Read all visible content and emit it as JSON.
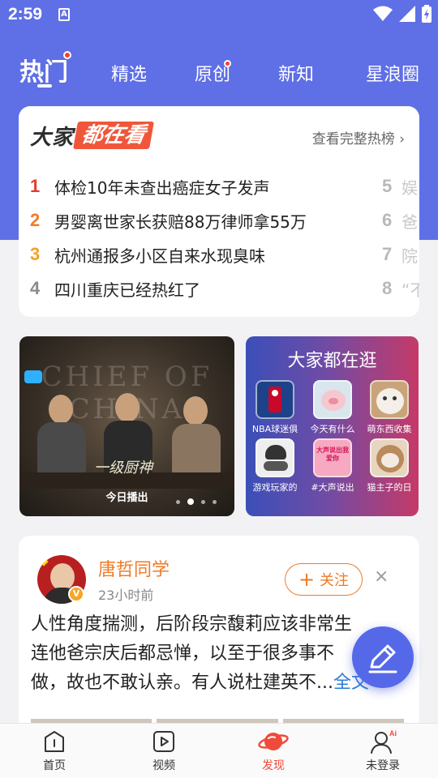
{
  "status_bar": {
    "time": "2:59",
    "indicator": "A"
  },
  "tabs": [
    {
      "label": "热门",
      "active": true,
      "has_dot": true
    },
    {
      "label": "精选",
      "active": false,
      "has_dot": false
    },
    {
      "label": "原创",
      "active": false,
      "has_dot": true
    },
    {
      "label": "新知",
      "active": false,
      "has_dot": false
    },
    {
      "label": "星浪圈",
      "active": false,
      "has_dot": false
    }
  ],
  "hot_board": {
    "logo_part1": "大家",
    "logo_part2": "都在看",
    "more_label": "查看完整热榜 ›",
    "items": [
      {
        "rank": "1",
        "text": "体检10年未查出癌症女子发声",
        "color": "#e63b2e"
      },
      {
        "rank": "2",
        "text": "男婴离世家长获赔88万律师拿55万",
        "color": "#f47a2a"
      },
      {
        "rank": "3",
        "text": "杭州通报多小区自来水现臭味",
        "color": "#f3a12b"
      },
      {
        "rank": "4",
        "text": "四川重庆已经热红了",
        "color": "#8c8c8c"
      }
    ],
    "items_peek": [
      {
        "rank": "5",
        "text": "娱"
      },
      {
        "rank": "6",
        "text": "爸"
      },
      {
        "rank": "7",
        "text": "院"
      },
      {
        "rank": "8",
        "text": "“不"
      }
    ]
  },
  "banner": {
    "bg_title": "CHIEF OF CHINA",
    "show_logo": "一级厨神",
    "caption": "今日播出",
    "dots": [
      false,
      true,
      false,
      false
    ]
  },
  "browse": {
    "title": "大家都在逛",
    "items": [
      {
        "label": "NBA球迷俱",
        "icon": "nba-logo-icon"
      },
      {
        "label": "今天有什么",
        "icon": "pig-icon"
      },
      {
        "label": "萌东西收集",
        "icon": "cat-icon"
      },
      {
        "label": "游戏玩家的",
        "icon": "gamer-icon"
      },
      {
        "label": "#大声说出",
        "icon": "pig-pink-icon",
        "badge": "大声说出我爱你"
      },
      {
        "label": "猫主子的日",
        "icon": "kitten-icon"
      }
    ]
  },
  "post": {
    "author": "唐哲同学",
    "verified": "V",
    "time": "23小时前",
    "follow_label": "关注",
    "close": "×",
    "lines": [
      "人性角度揣测，后阶段宗馥莉应该非常生",
      "连他爸宗庆后都忌惮，以至于很多事不",
      "做，故也不敢认亲。有人说杜建英不..."
    ],
    "more_label": "全文"
  },
  "bottom_nav": [
    {
      "label": "首页",
      "icon": "home-icon",
      "active": false
    },
    {
      "label": "视频",
      "icon": "video-icon",
      "active": false
    },
    {
      "label": "发现",
      "icon": "discover-planet-icon",
      "active": true
    },
    {
      "label": "未登录",
      "icon": "user-icon",
      "active": false
    }
  ],
  "colors": {
    "header_blue": "#5f6fe6",
    "accent_orange": "#f07a24",
    "discover_red": "#f04a3a",
    "link_blue": "#2b7bd6"
  }
}
